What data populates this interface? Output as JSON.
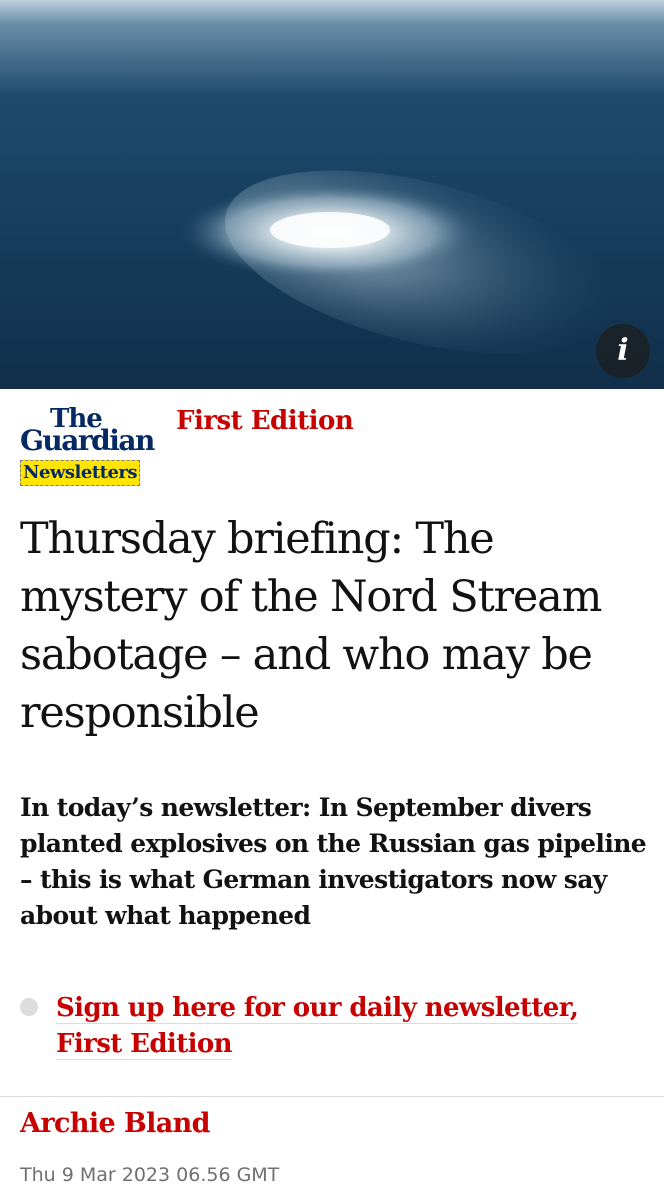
{
  "masthead": {
    "the": "The",
    "guardian": "Guardian",
    "newsletters": "Newsletters"
  },
  "hero": {
    "info_icon": "i"
  },
  "series": "First Edition",
  "headline": "Thursday briefing: The mystery of the Nord Stream sabotage – and who may be responsible",
  "standfirst": "In today’s newsletter: In September divers planted explosives on the Russian gas pipeline – this is what German investigators now say about what happened",
  "signup": {
    "link_text": "Sign up here for our daily newsletter, First Edition"
  },
  "byline": "Archie Bland",
  "dateline": "Thu 9 Mar 2023 06.56 GMT",
  "colors": {
    "brand_red": "#c70000",
    "brand_blue": "#052962",
    "highlight_yellow": "#ffe500"
  }
}
